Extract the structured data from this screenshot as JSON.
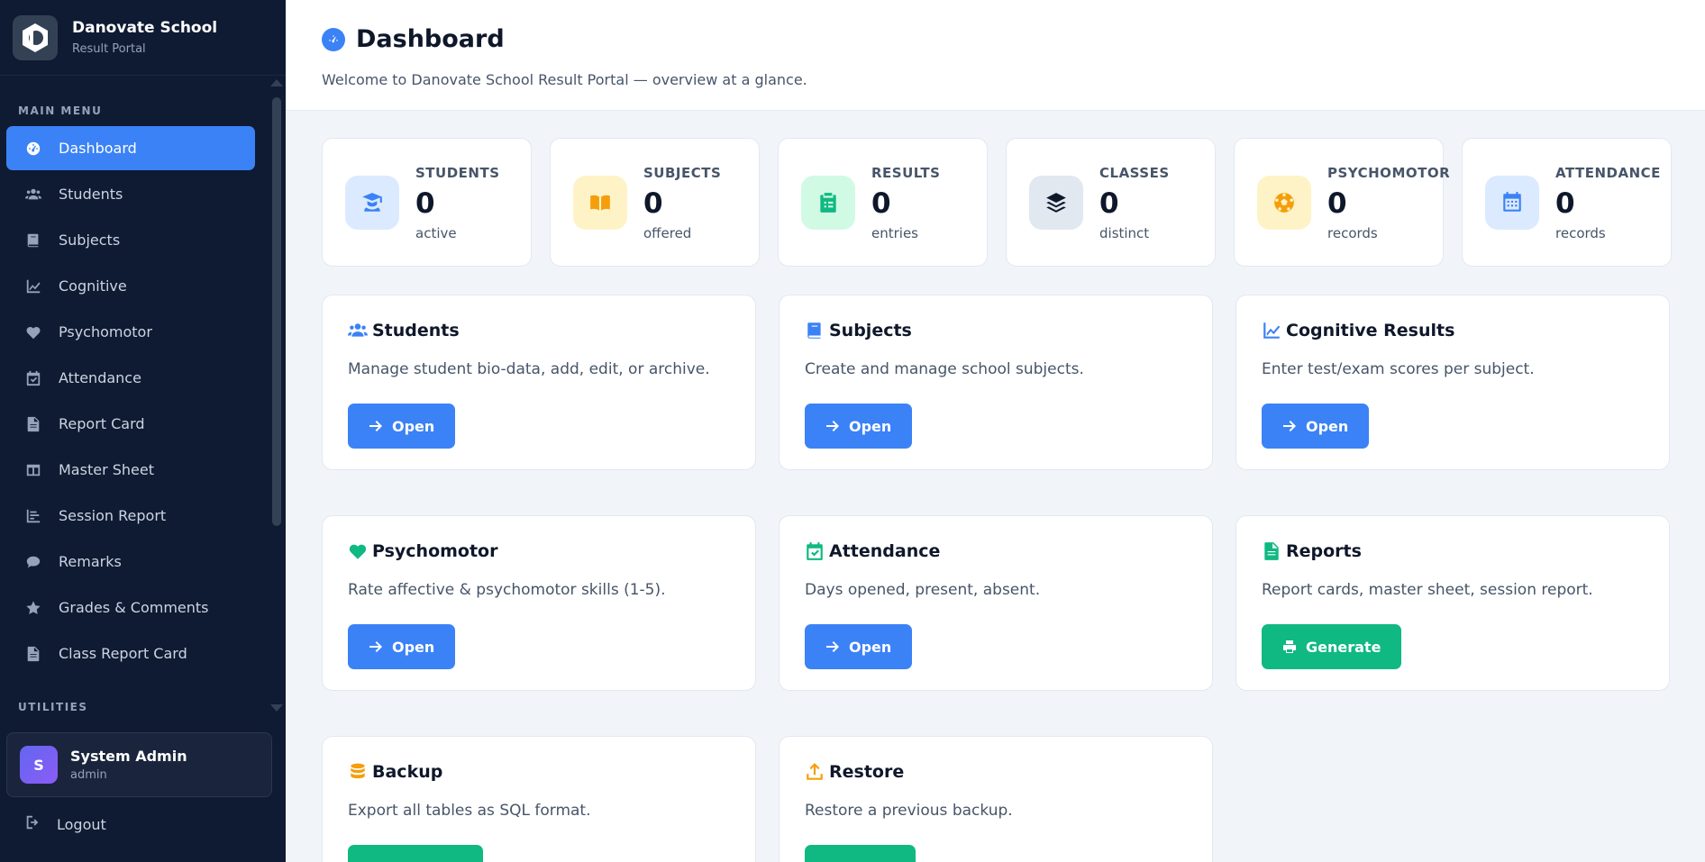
{
  "brand": {
    "title": "Danovate School",
    "subtitle": "Result Portal"
  },
  "sidebar": {
    "main_menu_label": "MAIN MENU",
    "items": [
      {
        "label": "Dashboard",
        "icon": "gauge-icon",
        "active": true
      },
      {
        "label": "Students",
        "icon": "users-icon"
      },
      {
        "label": "Subjects",
        "icon": "book-icon"
      },
      {
        "label": "Cognitive",
        "icon": "chart-line-icon"
      },
      {
        "label": "Psychomotor",
        "icon": "heart-icon"
      },
      {
        "label": "Attendance",
        "icon": "calendar-check-icon"
      },
      {
        "label": "Report Card",
        "icon": "file-icon"
      },
      {
        "label": "Master Sheet",
        "icon": "table-icon"
      },
      {
        "label": "Session Report",
        "icon": "bar-chart-icon"
      },
      {
        "label": "Remarks",
        "icon": "comment-icon"
      },
      {
        "label": "Grades & Comments",
        "icon": "star-icon"
      },
      {
        "label": "Class Report Card",
        "icon": "file-icon"
      }
    ],
    "utilities_label": "UTILITIES"
  },
  "user": {
    "initial": "S",
    "name": "System Admin",
    "role": "admin"
  },
  "logout_label": "Logout",
  "header": {
    "title": "Dashboard",
    "subtitle": "Welcome to Danovate School Result Portal — overview at a glance."
  },
  "stats": [
    {
      "label": "STUDENTS",
      "value": "0",
      "sub": "active",
      "icon": "user-graduate-icon",
      "bg": "#dbeafe",
      "color": "#3b82f6"
    },
    {
      "label": "SUBJECTS",
      "value": "0",
      "sub": "offered",
      "icon": "book-open-icon",
      "bg": "#fef3c7",
      "color": "#f59e0b"
    },
    {
      "label": "RESULTS",
      "value": "0",
      "sub": "entries",
      "icon": "clipboard-list-icon",
      "bg": "#d1fae5",
      "color": "#10b981"
    },
    {
      "label": "CLASSES",
      "value": "0",
      "sub": "distinct",
      "icon": "layers-icon",
      "bg": "#e2e8f0",
      "color": "#0f172a"
    },
    {
      "label": "PSYCHOMOTOR",
      "value": "0",
      "sub": "records",
      "icon": "futbol-icon",
      "bg": "#fef3c7",
      "color": "#f59e0b"
    },
    {
      "label": "ATTENDANCE",
      "value": "0",
      "sub": "records",
      "icon": "calendar-icon",
      "bg": "#dbeafe",
      "color": "#3b82f6"
    }
  ],
  "cards": [
    {
      "title": "Students",
      "desc": "Manage student bio-data, add, edit, or archive.",
      "button": "Open",
      "icon": "users-icon",
      "icon_color": "#3b82f6",
      "btn_style": "blue"
    },
    {
      "title": "Subjects",
      "desc": "Create and manage school subjects.",
      "button": "Open",
      "icon": "book-icon",
      "icon_color": "#3b82f6",
      "btn_style": "blue"
    },
    {
      "title": "Cognitive Results",
      "desc": "Enter test/exam scores per subject.",
      "button": "Open",
      "icon": "chart-line-icon",
      "icon_color": "#3b82f6",
      "btn_style": "blue"
    },
    {
      "title": "Psychomotor",
      "desc": "Rate affective & psychomotor skills (1-5).",
      "button": "Open",
      "icon": "heart-icon",
      "icon_color": "#10b981",
      "btn_style": "blue"
    },
    {
      "title": "Attendance",
      "desc": "Days opened, present, absent.",
      "button": "Open",
      "icon": "calendar-check-icon",
      "icon_color": "#10b981",
      "btn_style": "blue"
    },
    {
      "title": "Reports",
      "desc": "Report cards, master sheet, session report.",
      "button": "Generate",
      "icon": "file-icon",
      "icon_color": "#10b981",
      "btn_style": "green"
    },
    {
      "title": "Backup",
      "desc": "Export all tables as SQL format.",
      "button": "",
      "icon": "database-icon",
      "icon_color": "#f59e0b",
      "btn_style": "green"
    },
    {
      "title": "Restore",
      "desc": "Restore a previous backup.",
      "button": "",
      "icon": "upload-icon",
      "icon_color": "#f59e0b",
      "btn_style": "green"
    }
  ]
}
